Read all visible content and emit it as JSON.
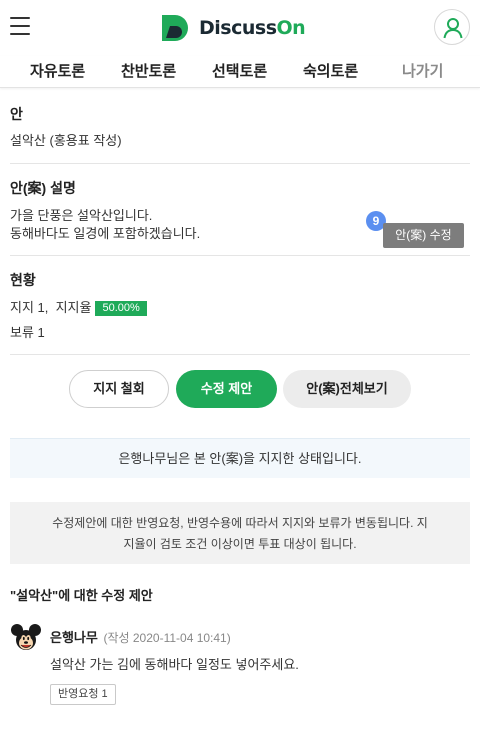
{
  "header": {
    "logo_text_a": "Discuss",
    "logo_text_b": "On",
    "brand_color": "#1faa59",
    "icons": {
      "menu": "hamburger-icon",
      "user": "user-icon"
    }
  },
  "nav": {
    "items": [
      "자유토론",
      "찬반토론",
      "선택토론",
      "숙의토론"
    ],
    "exit": "나가기"
  },
  "proposal": {
    "title": "안",
    "value": "설악산 (홍용표 작성)"
  },
  "description": {
    "title": "안(案) 설명",
    "line1": "가을 단풍은 설악산입니다.",
    "line2": "동해바다도 일경에 포함하겠습니다.",
    "edit_count": "9",
    "edit_label": "안(案) 수정"
  },
  "status": {
    "title": "현황",
    "support_text": "지지 1,  지지율",
    "support_rate": "50.00%",
    "hold_text": "보류 1"
  },
  "actions": {
    "withdraw": "지지 철회",
    "propose_edit": "수정 제안",
    "view_all": "안(案)전체보기"
  },
  "notice_support": "은행나무님은 본 안(案)을 지지한 상태입니다.",
  "notice_rules": {
    "line1": "수정제안에 대한 반영요청, 반영수용에 따라서 지지와 보류가 변동됩니다. 지",
    "line2": "지율이 검토 조건 이상이면 투표 대상이 됩니다."
  },
  "proposals": {
    "title": "\"설악산\"에 대한 수정 제안",
    "items": [
      {
        "author": "은행나무",
        "meta": "(작성 2020-11-04 10:41)",
        "text": "설악산 가는 김에 동해바다 일정도 넣어주세요.",
        "reflect_label": "반영요청 1"
      }
    ]
  }
}
